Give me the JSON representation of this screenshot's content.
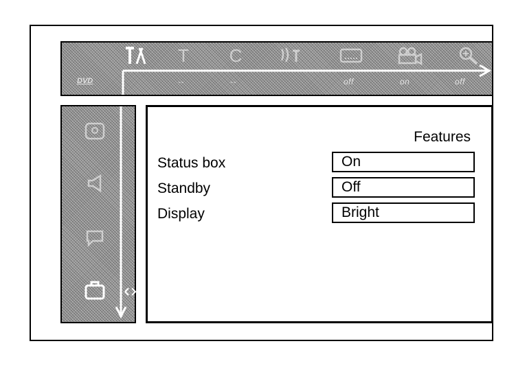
{
  "top_menu": {
    "disc_logo": "DVD",
    "icons": [
      {
        "name": "settings-tools-icon",
        "status": ""
      },
      {
        "name": "title-icon",
        "glyph": "T",
        "status": "--"
      },
      {
        "name": "chapter-icon",
        "glyph": "C",
        "status": "--"
      },
      {
        "name": "audio-icon",
        "status": "off"
      },
      {
        "name": "subtitle-icon",
        "status": "on"
      },
      {
        "name": "camera-angle-icon",
        "status": "off"
      },
      {
        "name": "zoom-icon",
        "status": ""
      }
    ]
  },
  "side_menu": {
    "icons": [
      "picture-icon",
      "sound-icon",
      "language-icon",
      "features-icon"
    ],
    "active": "features-icon"
  },
  "panel": {
    "title": "Features",
    "rows": [
      {
        "label": "Status box",
        "value": "On"
      },
      {
        "label": "Standby",
        "value": "Off"
      },
      {
        "label": "Display",
        "value": "Bright"
      }
    ]
  },
  "colors": {
    "menu_bg": "#9a9a9a",
    "text": "#000000",
    "icon": "#ffffff"
  }
}
